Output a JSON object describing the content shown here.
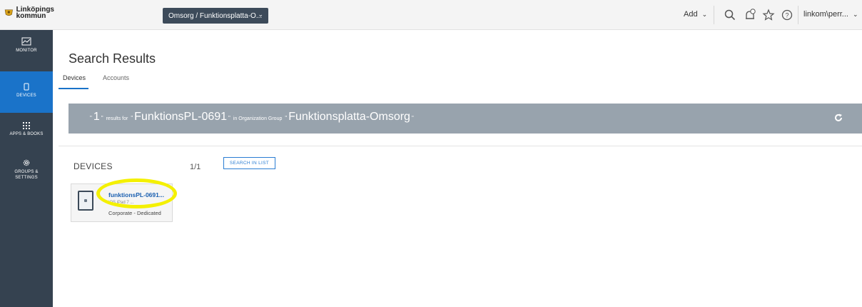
{
  "header": {
    "logo_line1": "Linköpings",
    "logo_line2": "kommun",
    "org_selector": "Omsorg / Funktionsplatta-O...",
    "add_label": "Add",
    "user_label": "linkom\\perr...",
    "accent_color": "#1a73c9",
    "icons": [
      "search-icon",
      "notifications-icon",
      "star-icon",
      "help-icon"
    ]
  },
  "nav": {
    "items": [
      {
        "label": "MONITOR",
        "icon": "monitor-icon"
      },
      {
        "label": "DEVICES",
        "icon": "device-icon"
      },
      {
        "label": "APPS & BOOKS",
        "icon": "apps-grid-icon"
      },
      {
        "label_line1": "GROUPS &",
        "label_line2": "SETTINGS",
        "icon": "gear-icon"
      }
    ],
    "active": "DEVICES"
  },
  "main": {
    "title": "Search Results",
    "tabs": [
      "Devices",
      "Accounts"
    ],
    "active_tab": "Devices",
    "banner": {
      "count": "1",
      "results_for": "results for",
      "query": "FunktionsPL-0691",
      "in_org_group": "in Organization Group",
      "org_group": "Funktionsplatta-Omsorg",
      "quote": "\""
    },
    "section": {
      "title": "DEVICES",
      "count": "1/1",
      "search_in_list": "SEARCH IN LIST"
    },
    "device": {
      "name": "funktionsPL-0691...",
      "subtitle": "iOS iPad 7 ...",
      "ownership": "Corporate - Dedicated"
    }
  }
}
